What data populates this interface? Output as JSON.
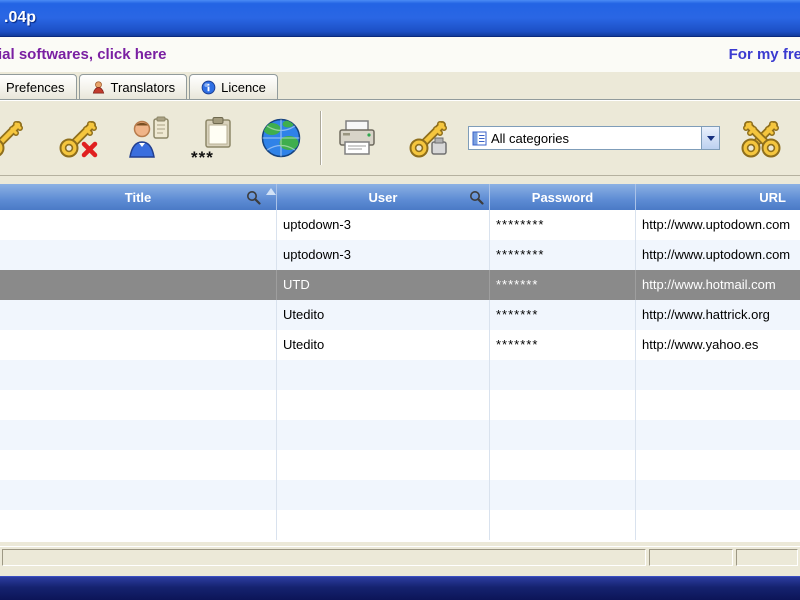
{
  "titlebar": {
    "title": ".04p"
  },
  "banner": {
    "left_link": "ial softwares, click here",
    "right_link": "For my fre"
  },
  "tabs": [
    {
      "label": "Prefences"
    },
    {
      "label": "Translators"
    },
    {
      "label": "Licence"
    }
  ],
  "toolbar": {
    "stars_label": "***",
    "category_select": {
      "value": "All categories"
    }
  },
  "grid": {
    "columns": [
      {
        "label": "Title"
      },
      {
        "label": "User"
      },
      {
        "label": "Password"
      },
      {
        "label": "URL"
      }
    ],
    "rows": [
      {
        "title": "",
        "user": "uptodown-3",
        "password": "********",
        "url": "http://www.uptodown.com"
      },
      {
        "title": "",
        "user": "uptodown-3",
        "password": "********",
        "url": "http://www.uptodown.com"
      },
      {
        "title": "",
        "user": "UTD",
        "password": "*******",
        "url": "http://www.hotmail.com"
      },
      {
        "title": "",
        "user": "Utedito",
        "password": "*******",
        "url": "http://www.hattrick.org"
      },
      {
        "title": "",
        "user": "Utedito",
        "password": "*******",
        "url": "http://www.yahoo.es"
      }
    ]
  },
  "colors": {
    "accent_blue": "#2a66e4",
    "header_blue": "#5e8cd4",
    "selected_gray": "#8a8a8a",
    "key_gold": "#f5c63e",
    "bottom_navy": "#15226f"
  }
}
